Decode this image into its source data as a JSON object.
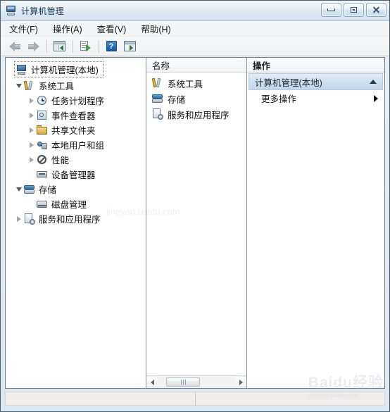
{
  "window": {
    "title": "计算机管理",
    "app_icon": "computer-management-icon",
    "controls": {
      "minimize": "minimize-icon",
      "maximize": "maximize-icon",
      "close": "close-icon"
    }
  },
  "menubar": {
    "items": [
      {
        "label": "文件(F)"
      },
      {
        "label": "操作(A)"
      },
      {
        "label": "查看(V)"
      },
      {
        "label": "帮助(H)"
      }
    ]
  },
  "toolbar": {
    "buttons": [
      {
        "name": "back-button",
        "icon": "back-arrow-icon"
      },
      {
        "name": "forward-button",
        "icon": "forward-arrow-icon"
      },
      {
        "name": "show-console-tree-button",
        "icon": "console-tree-pane-icon"
      },
      {
        "name": "export-list-button",
        "icon": "export-list-icon"
      },
      {
        "name": "help-button",
        "icon": "question-mark-icon",
        "glyph": "?"
      },
      {
        "name": "show-action-pane-button",
        "icon": "action-pane-icon"
      }
    ]
  },
  "tree": {
    "root": {
      "label": "计算机管理(本地)",
      "icon": "computer-icon",
      "selected": true
    },
    "nodes": [
      {
        "label": "系统工具",
        "icon": "tools-icon",
        "indent": 1,
        "twisty": "expanded"
      },
      {
        "label": "任务计划程序",
        "icon": "clock-icon",
        "indent": 2,
        "twisty": "collapsed"
      },
      {
        "label": "事件查看器",
        "icon": "event-viewer-icon",
        "indent": 2,
        "twisty": "collapsed"
      },
      {
        "label": "共享文件夹",
        "icon": "shared-folder-icon",
        "indent": 2,
        "twisty": "collapsed"
      },
      {
        "label": "本地用户和组",
        "icon": "local-users-icon",
        "indent": 2,
        "twisty": "collapsed"
      },
      {
        "label": "性能",
        "icon": "performance-icon",
        "indent": 2,
        "twisty": "collapsed"
      },
      {
        "label": "设备管理器",
        "icon": "device-manager-icon",
        "indent": 2,
        "twisty": "none"
      },
      {
        "label": "存储",
        "icon": "storage-icon",
        "indent": 1,
        "twisty": "expanded"
      },
      {
        "label": "磁盘管理",
        "icon": "disk-management-icon",
        "indent": 2,
        "twisty": "none"
      },
      {
        "label": "服务和应用程序",
        "icon": "services-icon",
        "indent": 1,
        "twisty": "collapsed"
      }
    ]
  },
  "list": {
    "column_header": "名称",
    "rows": [
      {
        "label": "系统工具",
        "icon": "tools-icon"
      },
      {
        "label": "存储",
        "icon": "storage-icon"
      },
      {
        "label": "服务和应用程序",
        "icon": "services-icon"
      }
    ],
    "scrollbar": {
      "left_arrow": "scroll-left-icon",
      "right_arrow": "scroll-right-icon",
      "thumb": "scroll-thumb"
    }
  },
  "actions": {
    "header": "操作",
    "group": {
      "title": "计算机管理(本地)",
      "collapse_icon": "chevron-up-icon"
    },
    "items": [
      {
        "label": "更多操作",
        "submenu_icon": "chevron-right-icon"
      }
    ]
  },
  "statusbar": {
    "left": "",
    "right": ""
  },
  "watermark": {
    "text": "Baidu经验",
    "subtext": "jingyan.baidu.com"
  },
  "colors": {
    "accent": "#2a6ba3",
    "window_frame": "#4a6272",
    "actions_group_bg": "#cfe0ef",
    "pane_border": "#8a97a3"
  }
}
